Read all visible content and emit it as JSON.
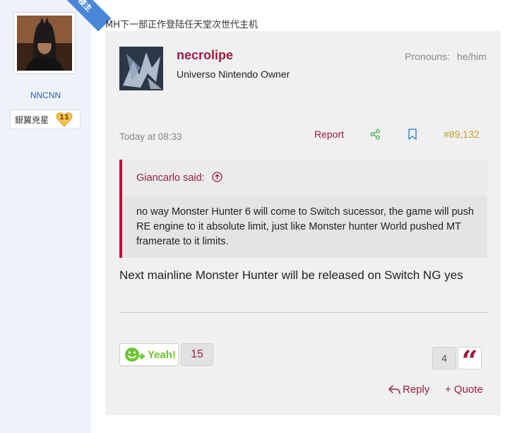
{
  "sidebar": {
    "ribbon_label": "楼主",
    "username": "NNCNN",
    "rank_label": "銀翼兇星",
    "rank_level": "11"
  },
  "thread": {
    "title": "MH下一部正作登陆任天堂次世代主机"
  },
  "post": {
    "author": "necrolipe",
    "user_title": "Universo Nintendo Owner",
    "pronouns_label": "Pronouns:",
    "pronouns_value": "he/him",
    "date": "Today at 08:33",
    "report_label": "Report",
    "post_number": "#89,132",
    "quote": {
      "author_label": "Giancarlo said:",
      "text": "no way Monster Hunter 6 will come to Switch sucessor, the game will push RE engine to it absolute limit, just like Monster hunter World pushed MT framerate to it limits."
    },
    "body": "Next mainline Monster Hunter will be released on Switch NG yes",
    "yeah_label": "Yeah!",
    "yeah_count": "15",
    "quote_count": "4",
    "quote_glyph": "“",
    "reply_label": "Reply",
    "add_quote_label": "+ Quote"
  },
  "colors": {
    "accent": "#9b1e3e",
    "yeah_green": "#6ec530",
    "post_number_gold": "#c4a02a",
    "sidebar_bg": "#eef3fa",
    "ribbon_blue": "#4a86d8"
  },
  "icons": {
    "share": "share-icon",
    "bookmark": "bookmark-icon",
    "reply": "reply-arrow-icon",
    "quote_jump": "up-arrow-circle-icon",
    "yeah": "yeah-plus-icon"
  }
}
